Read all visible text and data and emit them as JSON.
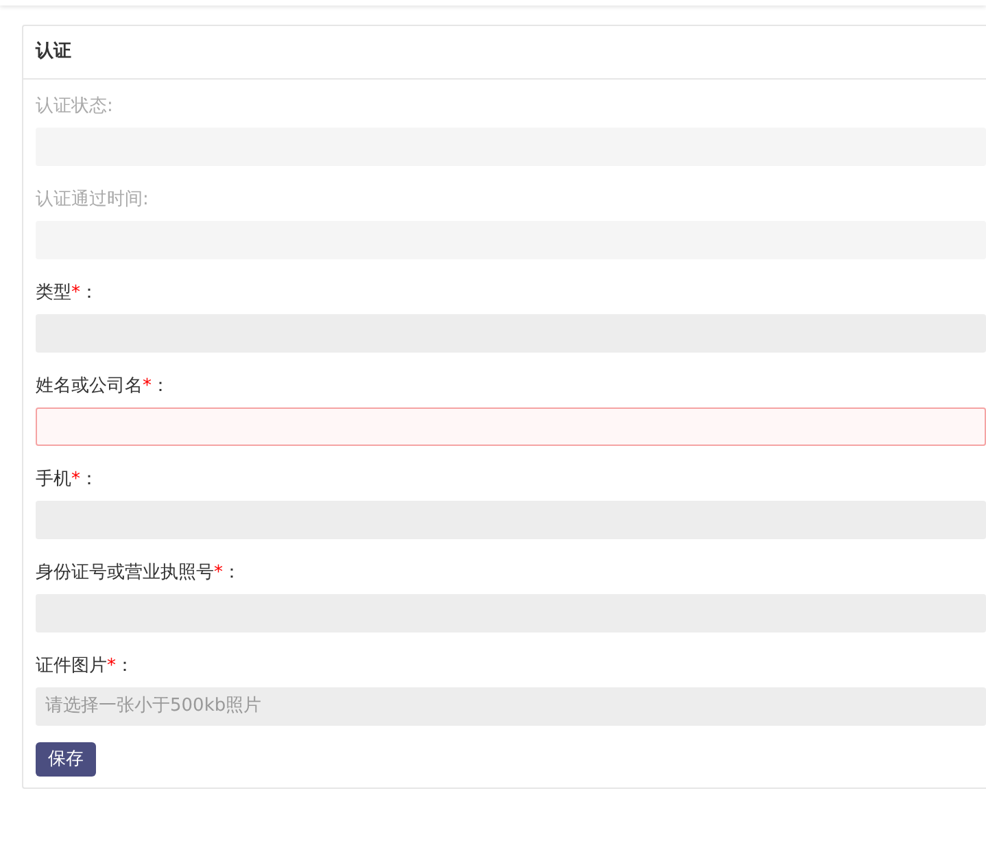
{
  "card": {
    "title": "认证"
  },
  "fields": [
    {
      "label": "认证状态",
      "colon": ":",
      "disabled": true,
      "invalid": false
    },
    {
      "label": "认证通过时间",
      "colon": ":",
      "disabled": true,
      "invalid": false
    },
    {
      "label": "类型",
      "colon": "：",
      "required_mark": "*",
      "disabled": false,
      "invalid": false
    },
    {
      "label": "姓名或公司名",
      "colon": "：",
      "required_mark": "*",
      "disabled": false,
      "invalid": true
    },
    {
      "label": "手机",
      "colon": "：",
      "required_mark": "*",
      "disabled": false,
      "invalid": false
    },
    {
      "label": "身份证号或营业执照号",
      "colon": "：",
      "required_mark": "*",
      "disabled": false,
      "invalid": false
    },
    {
      "label": "证件图片",
      "colon": "：",
      "required_mark": "*",
      "disabled": false,
      "invalid": false,
      "placeholder": "请选择一张小于500kb照片"
    }
  ],
  "buttons": [
    {
      "label": "保存"
    }
  ]
}
